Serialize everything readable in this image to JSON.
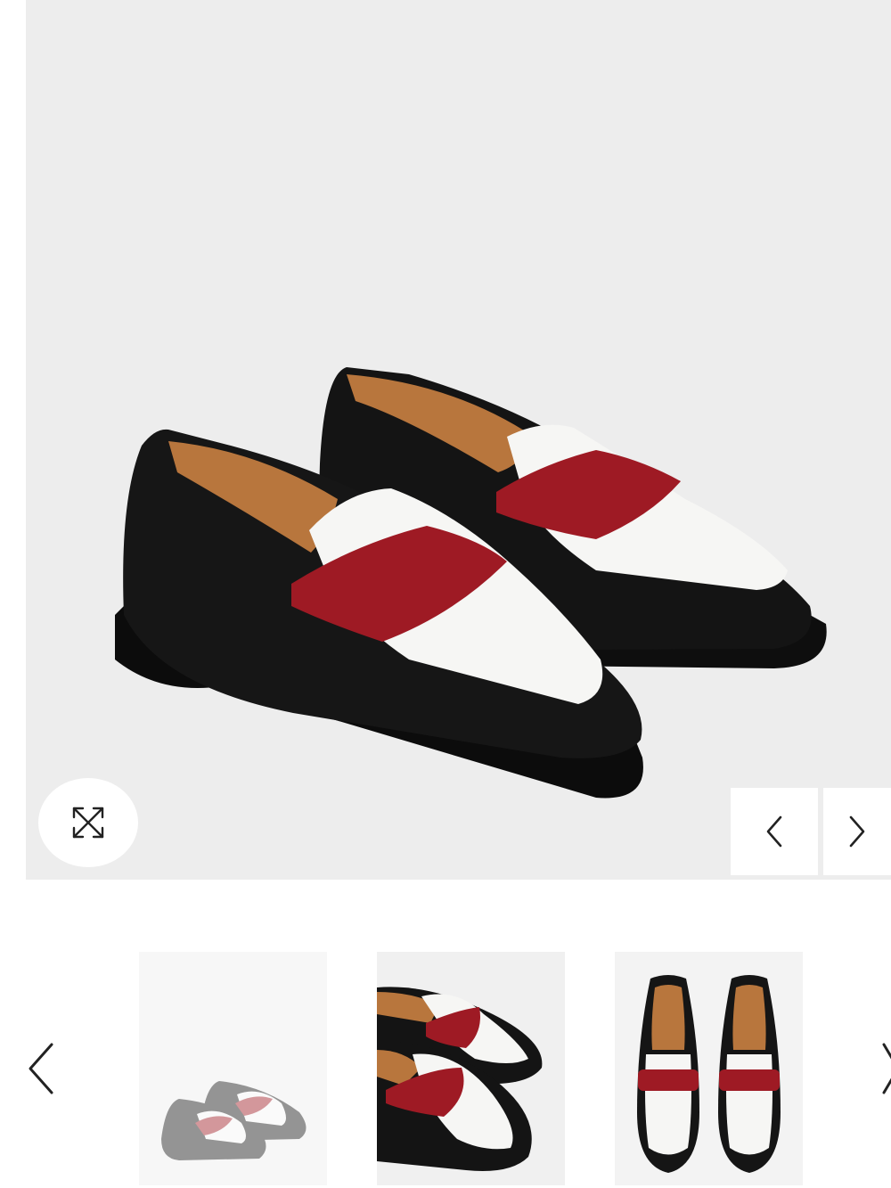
{
  "gallery": {
    "main_image": {
      "alt": "",
      "icon": "loafer-pair-photo"
    },
    "expand_icon": "expand-icon",
    "prev_icon": "chevron-left-icon",
    "next_icon": "chevron-right-icon",
    "active_thumbnail_index": 0,
    "thumbnails": [
      {
        "icon": "loafer-side-view"
      },
      {
        "icon": "loafer-closeup-view"
      },
      {
        "icon": "loafer-top-view"
      }
    ]
  },
  "colors": {
    "background": "#ededed",
    "leather_black": "#111111",
    "leather_white": "#f6f6f4",
    "suede_red": "#9e1a24",
    "lining_tan": "#b8763d"
  }
}
